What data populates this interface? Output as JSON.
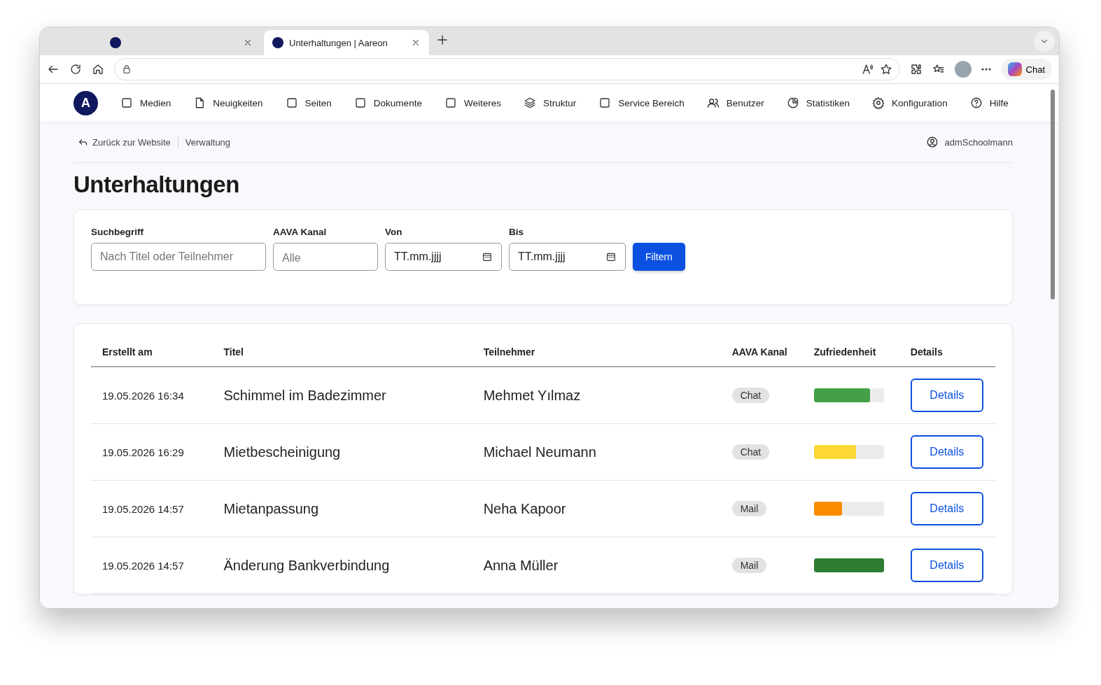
{
  "browser": {
    "tabs": [
      {
        "selected": false
      },
      {
        "title": "Unterhaltungen | Aareon",
        "selected": true
      }
    ],
    "chat_button": "Chat"
  },
  "nav": {
    "logo": "A",
    "items": [
      {
        "label": "Medien",
        "kind": "square"
      },
      {
        "label": "Neuigkeiten",
        "kind": "document"
      },
      {
        "label": "Seiten",
        "kind": "square"
      },
      {
        "label": "Dokumente",
        "kind": "square"
      },
      {
        "label": "Weiteres",
        "kind": "square"
      },
      {
        "label": "Struktur",
        "kind": "layers"
      },
      {
        "label": "Service Bereich",
        "kind": "square"
      },
      {
        "label": "Benutzer",
        "kind": "users"
      },
      {
        "label": "Statistiken",
        "kind": "pie"
      },
      {
        "label": "Konfiguration",
        "kind": "gear"
      },
      {
        "label": "Hilfe",
        "kind": "help"
      }
    ]
  },
  "breadcrumb": {
    "back": "Zurück zur Website",
    "current": "Verwaltung",
    "user": "admSchoolmann"
  },
  "title": "Unterhaltungen",
  "filter": {
    "fields": [
      {
        "label": "Suchbegriff",
        "kind": "text",
        "placeholder": "Nach Titel oder Teilnehmer"
      },
      {
        "label": "AAVA Kanal",
        "kind": "select",
        "placeholder": "Alle"
      },
      {
        "label": "Von",
        "kind": "date",
        "value": "TT.mm.jjjj"
      },
      {
        "label": "Bis",
        "kind": "date",
        "value": "TT.mm.jjjj"
      }
    ],
    "button": "Filtern"
  },
  "table": {
    "columns": [
      "Erstellt am",
      "Titel",
      "Teilnehmer",
      "AAVA Kanal",
      "Zufriedenheit",
      "Details"
    ],
    "rows": [
      {
        "created": "19.05.2026 16:34",
        "title": "Schimmel im Badezimmer",
        "participant": "Mehmet Yılmaz",
        "channel": "Chat",
        "level": 0.8,
        "color": "#43a047",
        "action": "Details"
      },
      {
        "created": "19.05.2026 16:29",
        "title": "Mietbescheinigung",
        "participant": "Michael Neumann",
        "channel": "Chat",
        "level": 0.6,
        "color": "#fdd835",
        "action": "Details"
      },
      {
        "created": "19.05.2026 14:57",
        "title": "Mietanpassung",
        "participant": "Neha Kapoor",
        "channel": "Mail",
        "level": 0.4,
        "color": "#fb8c00",
        "action": "Details"
      },
      {
        "created": "19.05.2026 14:57",
        "title": "Änderung Bankverbindung",
        "participant": "Anna Müller",
        "channel": "Mail",
        "level": 1,
        "color": "#2e7d32",
        "action": "Details"
      }
    ]
  }
}
